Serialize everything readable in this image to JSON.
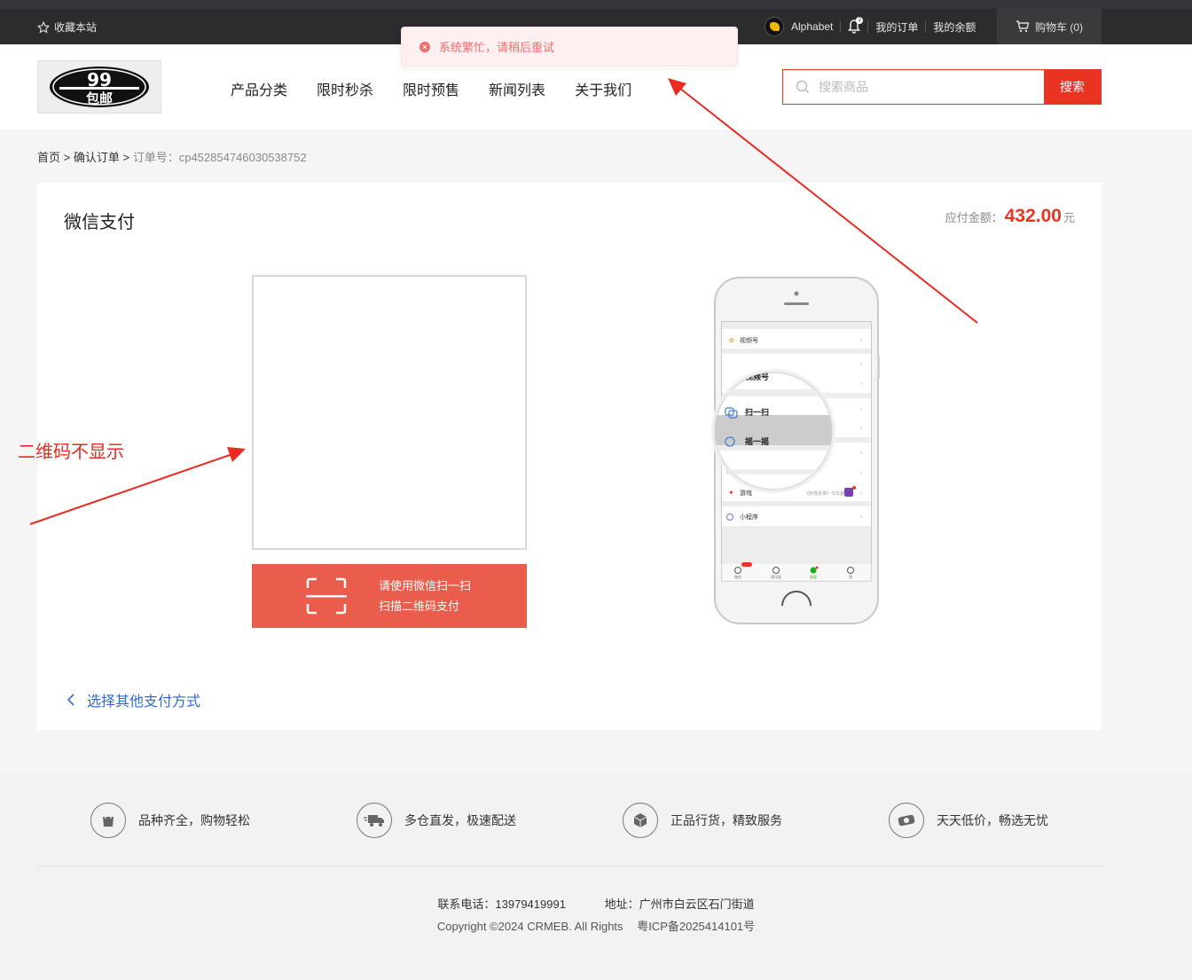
{
  "topbar": {
    "favorite_label": "收藏本站",
    "username": "Alphabet",
    "notification_count": "2",
    "my_orders": "我的订单",
    "my_balance": "我的余额",
    "cart_label": "购物车 (0)"
  },
  "logo": {
    "line1": "99",
    "line2": "包邮"
  },
  "nav": {
    "items": [
      "产品分类",
      "限时秒杀",
      "限时预售",
      "新闻列表",
      "关于我们"
    ]
  },
  "search": {
    "placeholder": "搜索商品",
    "button_label": "搜索"
  },
  "toast": {
    "message": "系统繁忙，请稍后重试"
  },
  "breadcrumb": {
    "home": "首页",
    "confirm": "确认订单",
    "order_no": "订单号：cp452854746030538752"
  },
  "payment": {
    "title": "微信支付",
    "amount_label": "应付金额：",
    "amount_value": "432.00",
    "amount_unit": "元",
    "tip_line1": "请使用微信扫一扫",
    "tip_line2": "扫描二维码支付",
    "back_label": "选择其他支付方式"
  },
  "phone_menu": {
    "channels": "视频号",
    "scan": "扫一扫",
    "shake": "摇一摇",
    "shopping": "购物",
    "games": "游戏",
    "game_note": "《妖怪名单》今日首发",
    "miniprogram": "小程序",
    "tabs": [
      "微信",
      "通讯录",
      "发现",
      "我"
    ]
  },
  "annotation": {
    "text": "二维码不显示"
  },
  "footer": {
    "features": [
      "品种齐全，购物轻松",
      "多仓直发，极速配送",
      "正品行货，精致服务",
      "天天低价，畅选无忧"
    ],
    "phone": "联系电话：13979419991",
    "address": "地址：广州市白云区石门街道",
    "copyright": "Copyright ©2024 CRMEB. All Rights",
    "icp": "粤ICP备2025414101号"
  },
  "colors": {
    "accent": "#e93323",
    "tip_bg": "#ea5c4b",
    "link": "#2e6bd2",
    "annotation": "#e92b22"
  }
}
